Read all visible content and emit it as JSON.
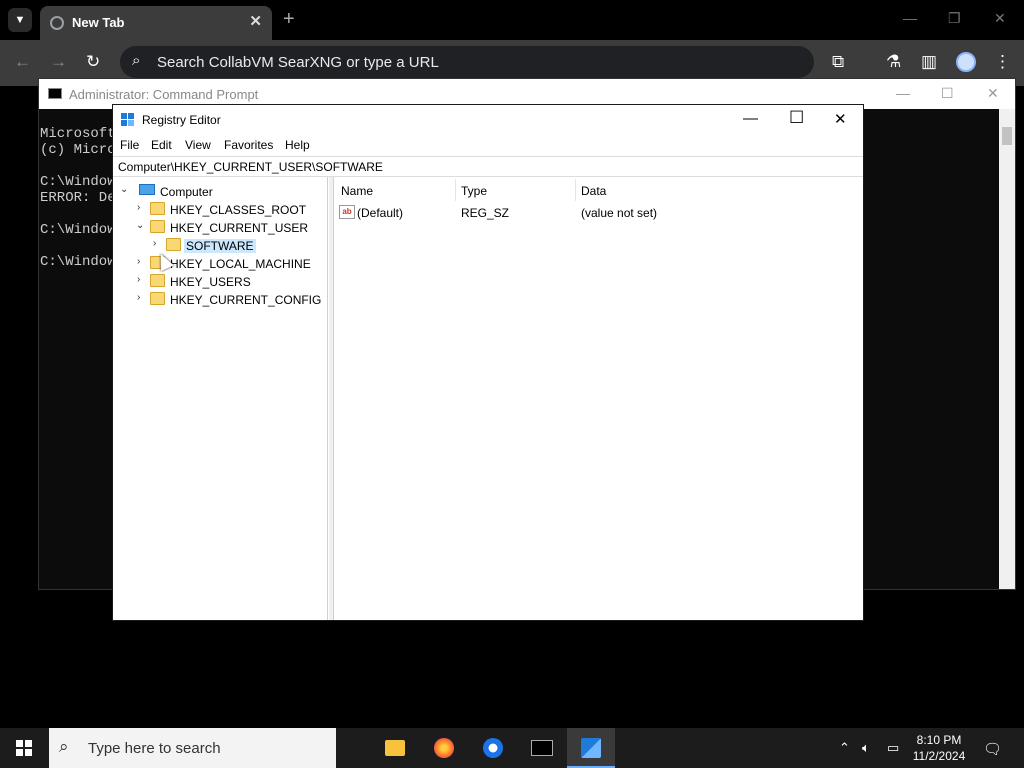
{
  "browser": {
    "tab_title": "New Tab",
    "tab_close": "✕",
    "new_tab": "+",
    "omnibox_text": "Search CollabVM SearXNG or type a URL",
    "win_minimize": "—",
    "win_restore": "❐",
    "win_close": "✕"
  },
  "cmd": {
    "title": "Administrator: Command Prompt",
    "lines": [
      "Microsoft",
      "(c) Micro",
      "",
      "C:\\Window",
      "ERROR: De",
      "",
      "C:\\Window",
      "",
      "C:\\Window"
    ]
  },
  "regedit": {
    "title": "Registry Editor",
    "menu": [
      "File",
      "Edit",
      "View",
      "Favorites",
      "Help"
    ],
    "address": "Computer\\HKEY_CURRENT_USER\\SOFTWARE",
    "tree": {
      "root": "Computer",
      "nodes": [
        "HKEY_CLASSES_ROOT",
        "HKEY_CURRENT_USER",
        "SOFTWARE",
        "HKEY_LOCAL_MACHINE",
        "HKEY_USERS",
        "HKEY_CURRENT_CONFIG"
      ]
    },
    "columns": [
      "Name",
      "Type",
      "Data"
    ],
    "values": [
      {
        "name": "(Default)",
        "type": "REG_SZ",
        "data": "(value not set)"
      }
    ],
    "minimize": "—",
    "maximize": "☐",
    "close": "✕"
  },
  "taskbar": {
    "search_placeholder": "Type here to search",
    "time": "8:10 PM",
    "date": "11/2/2024",
    "apps": [
      "file-explorer",
      "firefox",
      "chrome",
      "terminal",
      "registry-editor"
    ],
    "active_app": "registry-editor"
  },
  "colors": {
    "accent": "#1f7ad8",
    "selection": "#cce8ff",
    "folder": "#f8d775"
  }
}
